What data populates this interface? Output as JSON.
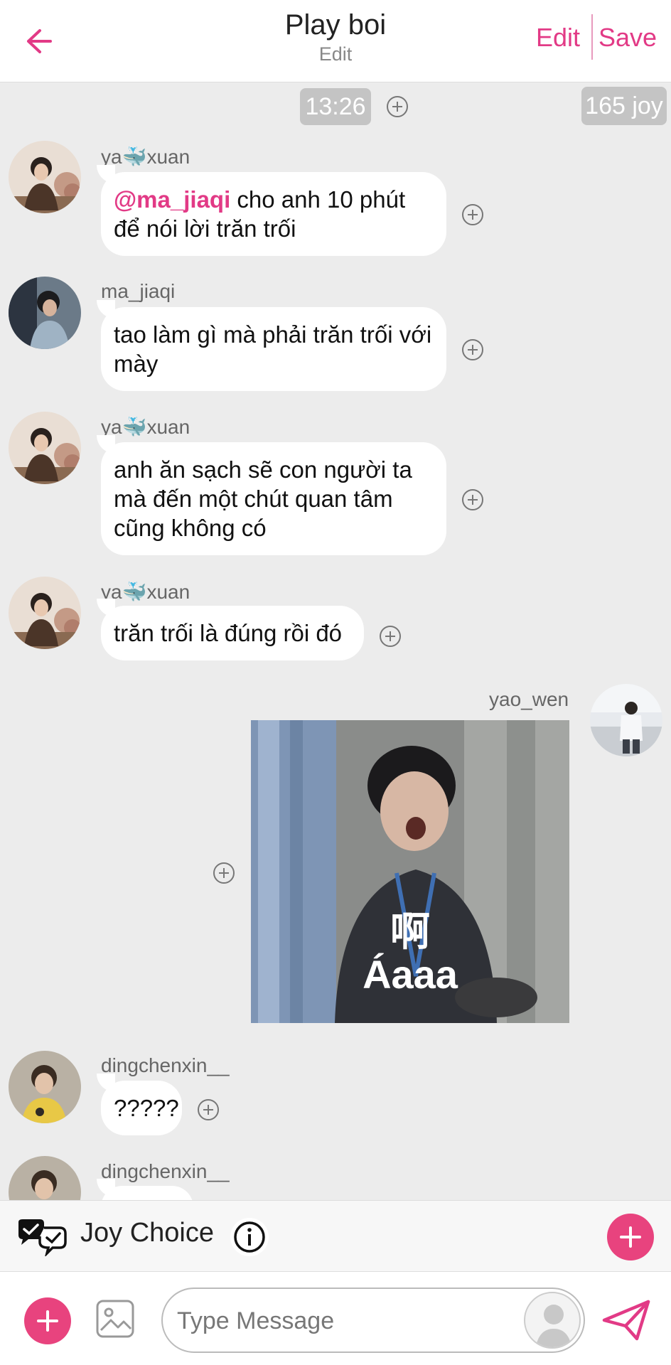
{
  "header": {
    "title": "Play boi",
    "subtitle": "Edit",
    "edit_label": "Edit",
    "save_label": "Save"
  },
  "meta": {
    "time": "13:26",
    "joy": "165 joy"
  },
  "messages": [
    {
      "user_prefix": "ya",
      "user_suffix": "xuan",
      "mention": "@ma_jiaqi",
      "text": " cho anh 10 phút để nói lời trăn trối"
    },
    {
      "user": "ma_jiaqi",
      "text": "tao làm gì mà phải trăn trối với mày"
    },
    {
      "user_prefix": "ya",
      "user_suffix": "xuan",
      "text": "anh ăn sạch sẽ con người ta mà đến một chút quan tâm cũng không có"
    },
    {
      "user_prefix": "ya",
      "user_suffix": "xuan",
      "text": "trăn trối là đúng rồi đó"
    },
    {
      "user": "yao_wen",
      "sticker_cn": "啊",
      "sticker_vi": "Áaaa"
    },
    {
      "user": "dingchenxin__",
      "text": "?????"
    },
    {
      "user": "dingchenxin__"
    }
  ],
  "joy_choice": {
    "label": "Joy Choice"
  },
  "input": {
    "placeholder": "Type Message"
  },
  "colors": {
    "accent": "#e23a86",
    "background": "#ececec"
  }
}
